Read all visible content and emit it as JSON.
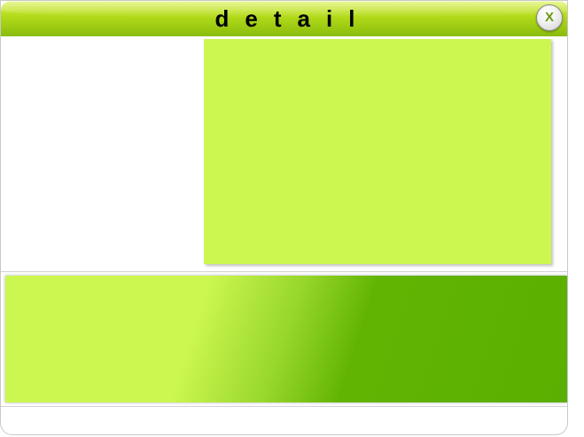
{
  "window": {
    "title": "detail",
    "close_label": "X"
  },
  "colors": {
    "title_bar": "#b2da1a",
    "image_panel": "#ccf750",
    "banner_light": "#ccf750",
    "banner_dark": "#5ab000",
    "close_glyph": "#6a9a12"
  },
  "icons": {
    "close": "close-icon"
  }
}
